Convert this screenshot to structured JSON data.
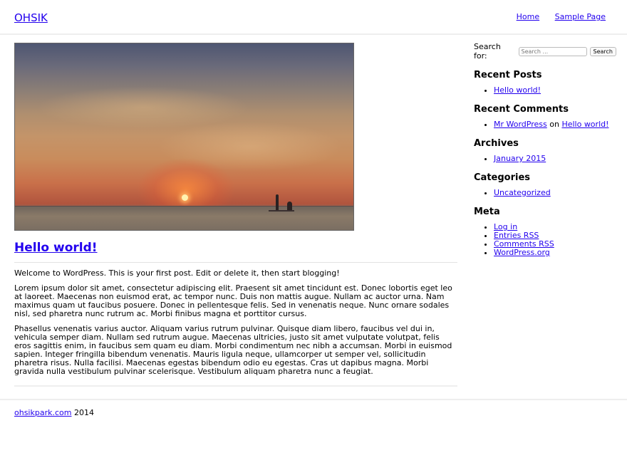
{
  "header": {
    "site_title": "OHSIK",
    "nav": [
      {
        "label": "Home"
      },
      {
        "label": "Sample Page"
      }
    ]
  },
  "post": {
    "image_alt": "Sunset over the sea with two paddleboarders",
    "title": "Hello world!",
    "paragraphs": [
      "Welcome to WordPress. This is your first post. Edit or delete it, then start blogging!",
      "Lorem ipsum dolor sit amet, consectetur adipiscing elit. Praesent sit amet tincidunt est. Donec lobortis eget leo at laoreet. Maecenas non euismod erat, ac tempor nunc. Duis non mattis augue. Nullam ac auctor urna. Nam maximus quam ut faucibus posuere. Donec in pellentesque felis. Sed in venenatis neque. Nunc ornare sodales nisl, sed pharetra nunc rutrum ac. Morbi finibus magna et porttitor cursus.",
      "Phasellus venenatis varius auctor. Aliquam varius rutrum pulvinar. Quisque diam libero, faucibus vel dui in, vehicula semper diam. Nullam sed rutrum augue. Maecenas ultricies, justo sit amet vulputate volutpat, felis eros sagittis enim, in faucibus sem quam eu diam. Morbi condimentum nec nibh a accumsan. Morbi in euismod sapien. Integer fringilla bibendum venenatis. Mauris ligula neque, ullamcorper ut semper vel, sollicitudin pharetra risus. Nulla facilisi. Maecenas egestas bibendum odio eu egestas. Cras ut dapibus magna. Morbi gravida nulla vestibulum pulvinar scelerisque. Vestibulum aliquam pharetra nunc a feugiat."
    ]
  },
  "sidebar": {
    "search": {
      "label": "Search for:",
      "placeholder": "Search ...",
      "button": "Search"
    },
    "recent_posts": {
      "title": "Recent Posts",
      "items": [
        "Hello world!"
      ]
    },
    "recent_comments": {
      "title": "Recent Comments",
      "author": "Mr WordPress",
      "connector": "on",
      "post": "Hello world!"
    },
    "archives": {
      "title": "Archives",
      "items": [
        "January 2015"
      ]
    },
    "categories": {
      "title": "Categories",
      "items": [
        "Uncategorized"
      ]
    },
    "meta": {
      "title": "Meta",
      "items": [
        "Log in",
        "Entries RSS",
        "Comments RSS",
        "WordPress.org"
      ]
    }
  },
  "footer": {
    "link": "ohsikpark.com",
    "year": "2014"
  },
  "colors": {
    "link": "#2200ee",
    "divider": "#eeeeee"
  }
}
